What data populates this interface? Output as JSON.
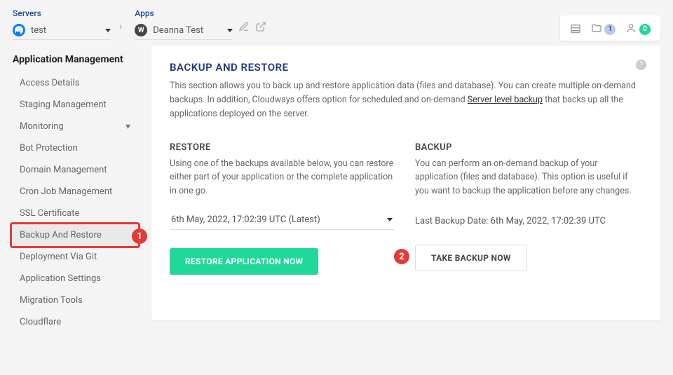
{
  "breadcrumb": {
    "servers_label": "Servers",
    "server_name": "test",
    "apps_label": "Apps",
    "app_name": "Deanna Test"
  },
  "topbar": {
    "folder_badge": "1",
    "user_badge": "0"
  },
  "sidebar": {
    "title": "Application Management",
    "items": [
      {
        "label": "Access Details"
      },
      {
        "label": "Staging Management"
      },
      {
        "label": "Monitoring",
        "expandable": true
      },
      {
        "label": "Bot Protection"
      },
      {
        "label": "Domain Management"
      },
      {
        "label": "Cron Job Management"
      },
      {
        "label": "SSL Certificate"
      },
      {
        "label": "Backup And Restore",
        "active": true
      },
      {
        "label": "Deployment Via Git"
      },
      {
        "label": "Application Settings"
      },
      {
        "label": "Migration Tools"
      },
      {
        "label": "Cloudflare"
      }
    ]
  },
  "main": {
    "title": "BACKUP AND RESTORE",
    "desc_pre": "This section allows you to back up and restore application data (files and database). You can create multiple on-demand backups. In addition, Cloudways offers option for scheduled and on-demand ",
    "desc_link": "Server level backup",
    "desc_post": " that backs up all the applications deployed on the server.",
    "restore": {
      "title": "RESTORE",
      "desc": "Using one of the backups available below, you can restore either part of your application or the complete application in one go.",
      "selected_backup": "6th May, 2022, 17:02:39 UTC (Latest)",
      "button": "RESTORE APPLICATION NOW"
    },
    "backup": {
      "title": "BACKUP",
      "desc": "You can perform an on-demand backup of your application (files and database). This option is useful if you want to backup the application before any changes.",
      "last_label": "Last Backup Date: 6th May, 2022, 17:02:39 UTC",
      "button": "TAKE BACKUP NOW"
    }
  },
  "callouts": {
    "one": "1",
    "two": "2"
  }
}
